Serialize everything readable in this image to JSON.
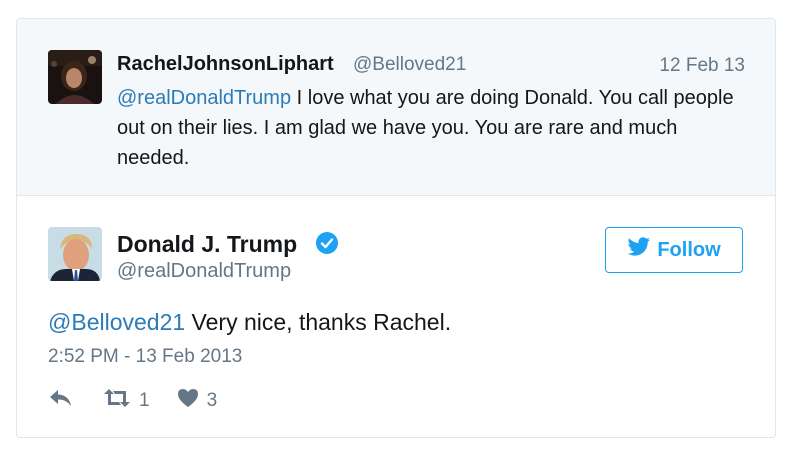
{
  "parent_tweet": {
    "author_name": "RachelJohnsonLiphart",
    "author_handle": "@Belloved21",
    "date": "12 Feb 13",
    "mention": "@realDonaldTrump",
    "text": " I love what you are doing Donald. You call people out on their lies. I am glad we have you. You are rare and much needed."
  },
  "tweet": {
    "author_name": "Donald J. Trump",
    "author_handle": "@realDonaldTrump",
    "verified_icon": "verified-badge-icon",
    "follow_label": "Follow",
    "mention": "@Belloved21",
    "text": " Very nice, thanks Rachel.",
    "timestamp": "2:52 PM - 13 Feb 2013",
    "retweet_count": "1",
    "like_count": "3"
  },
  "colors": {
    "accent": "#1da1f2",
    "link": "#2b7bb9",
    "muted": "#657786",
    "parent_bg": "#f5f8fa"
  }
}
